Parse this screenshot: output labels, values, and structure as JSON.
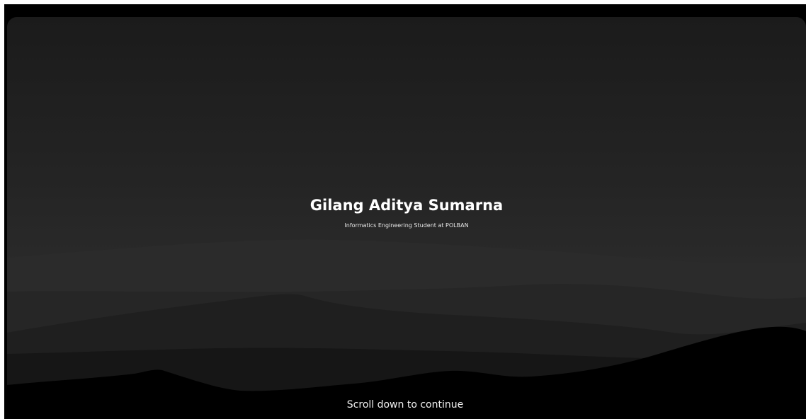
{
  "hero": {
    "title": "Gilang Aditya Sumarna",
    "subtitle": "Informatics Engineering Student at POLBAN",
    "scroll_hint": "Scroll down to continue"
  },
  "colors": {
    "background": "#000000",
    "sky_top": "#1b1b1b",
    "sky_mid": "#2a2a2a",
    "text": "#ffffff"
  }
}
